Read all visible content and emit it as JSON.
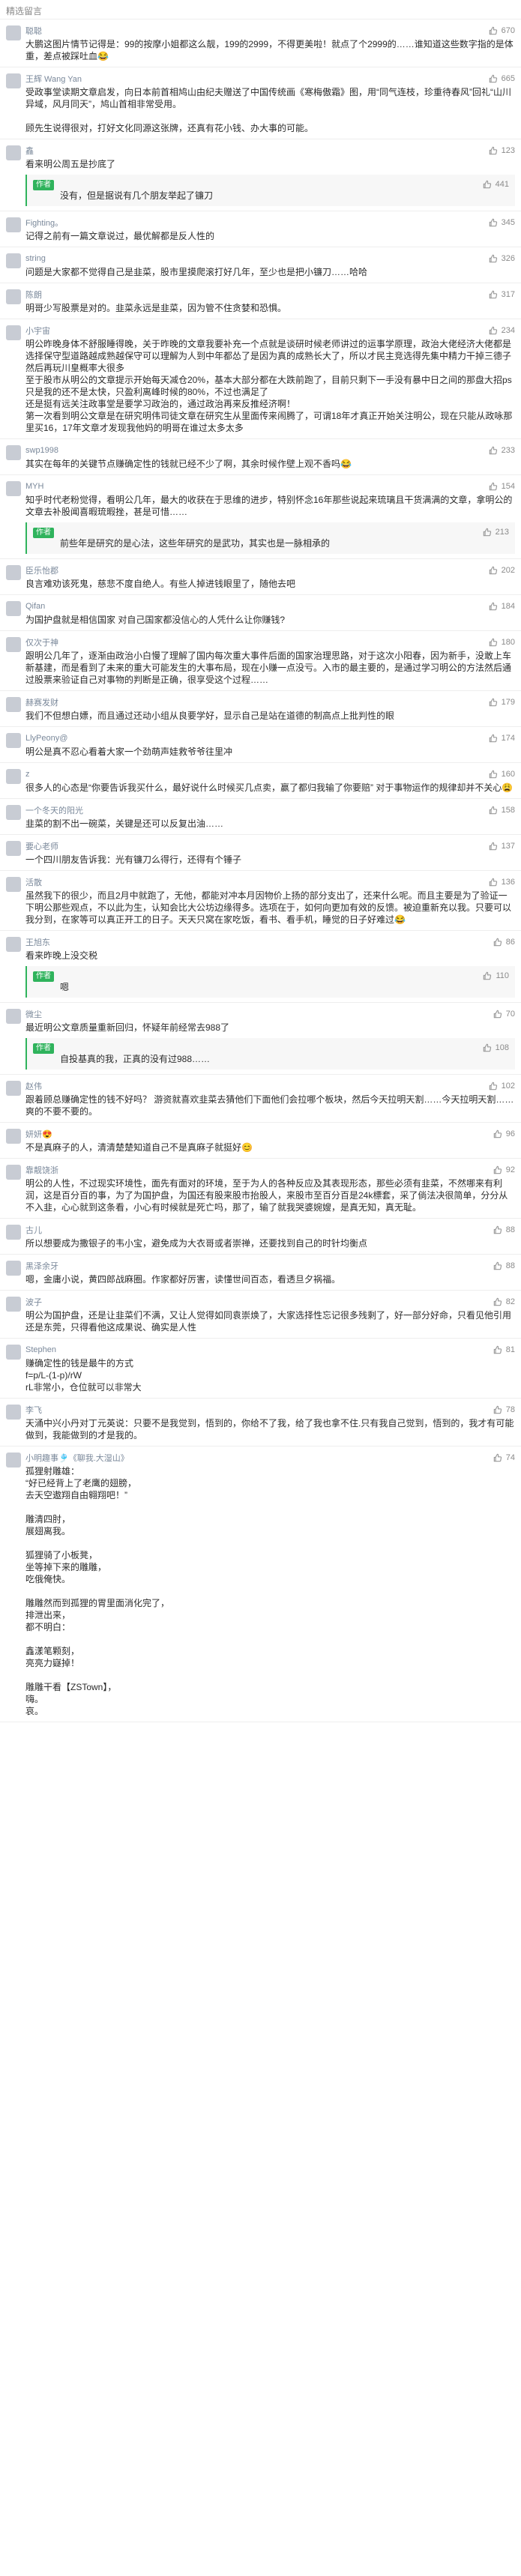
{
  "header": {
    "title": "精选留言"
  },
  "comments": [
    {
      "name": "聪聪",
      "likes": "670",
      "text": "大鹏这图片情节记得是：99的按摩小姐都这么靓，199的2999，不得更美啦！就点了个2999的……谁知道这些数字指的是体重，差点被踩吐血😂",
      "reply": null
    },
    {
      "name": "王辉 Wang Yan",
      "likes": "665",
      "text": "受政事堂读期文章启发，向日本前首相鸠山由纪夫赠送了中国传统画《寒梅傲霜》图，用“同气连枝，珍重待春风”回礼“山川异域，风月同天”，鸠山首相非常受用。\n\n顾先生说得很对，打好文化同源这张牌，还真有花小钱、办大事的可能。",
      "reply": null
    },
    {
      "name": "鑫",
      "likes": "123",
      "text": "看来明公周五是抄底了",
      "reply": {
        "badge": "作者",
        "likes": "441",
        "text": "没有，但是据说有几个朋友举起了镰刀"
      }
    },
    {
      "name": "Fighting。",
      "likes": "345",
      "text": "记得之前有一篇文章说过，最优解都是反人性的",
      "reply": null
    },
    {
      "name": "string",
      "likes": "326",
      "text": "问题是大家都不觉得自己是韭菜，股市里摸爬滚打好几年，至少也是把小镰刀……哈哈",
      "reply": null
    },
    {
      "name": "陈朗",
      "likes": "317",
      "text": "明哥少写股票是对的。韭菜永远是韭菜，因为管不住贪婪和恐惧。",
      "reply": null
    },
    {
      "name": "小宇宙",
      "likes": "234",
      "text": "明公昨晚身体不舒服睡得晚，关于昨晚的文章我要补充一个点就是谈研时候老师讲过的运事学原理，政治大佬经济大佬都是选择保守型道路越成熟越保守可以理解为人到中年都怂了是因为真的成熟长大了，所以才民主竞选得先集中精力干掉三德子然后再玩川皇概率大很多\n至于股市从明公的文章提示开始每天减仓20%，基本大部分都在大跌前跑了，目前只剩下一手没有暴中日之间的那盘大招ps只是我的还不是太快，只盈利离峰时候的80%，不过也满足了\n还是挺有远关注政事堂是要学习政治的，通过政治再来反推经济啊！\n第一次看到明公文章是在研究明伟司徒文章在研究生从里面传来闹腾了，可谓18年才真正开始关注明公，现在只能从政咏那里买16，17年文章才发现我他妈的明哥在谁过太多太多",
      "reply": null
    },
    {
      "name": "swp1998",
      "likes": "233",
      "text": "其实在每年的关键节点赚确定性的钱就已经不少了啊，其余时候作壁上观不香吗😂",
      "reply": null
    },
    {
      "name": "MYH",
      "likes": "154",
      "text": "知乎时代老粉觉得，看明公几年，最大的收获在于思维的进步，特别怀念16年那些说起来琉璃且干货满满的文章，拿明公的文章去补股闻喜暇琉暇挫，甚是可惜……",
      "reply": {
        "badge": "作者",
        "likes": "213",
        "text": "前些年是研究的是心法，这些年研究的是武功，其实也是一脉相承的"
      }
    },
    {
      "name": "臣乐怡郡",
      "likes": "202",
      "text": "良言难劝该死鬼，慈悲不度自绝人。有些人掉进钱眼里了，随他去吧",
      "reply": null
    },
    {
      "name": "Qifan",
      "likes": "184",
      "text": "为国护盘就是相信国家 对自己国家都没信心的人凭什么让你赚钱?",
      "reply": null
    },
    {
      "name": "仅次于神",
      "likes": "180",
      "text": "跟明公几年了，逐渐由政治小白慢了理解了国内每次重大事件后面的国家治理思路，对于这次小阳春，因为新手，没敢上车新基建，而是看到了未来的重大可能发生的大事布局，现在小赚一点没亏。入市的最主要的，是通过学习明公的方法然后通过股票来验证自己对事物的判断是正确，很享受这个过程……",
      "reply": null
    },
    {
      "name": "赫赛发财",
      "likes": "179",
      "text": "我们不但想白嫖，而且通过还动小组从良要学好，显示自己是站在道德的制高点上批判性的眼",
      "reply": null
    },
    {
      "name": "LlyPeony@",
      "likes": "174",
      "text": "明公是真不忍心看着大家一个劲萌声娃救爷爷往里冲",
      "reply": null
    },
    {
      "name": "z",
      "likes": "160",
      "text": "很多人的心态是“你要告诉我买什么，最好说什么时候买几点卖，赢了都归我输了你要赔” 对于事物运作的规律却并不关心😩",
      "reply": null
    },
    {
      "name": "一个冬天的阳光",
      "likes": "158",
      "text": "韭菜的割不出一碗菜，关键是还可以反复出油……",
      "reply": null
    },
    {
      "name": "要心老师",
      "likes": "137",
      "text": "一个四川朋友告诉我：光有镰刀么得行，还得有个锤子",
      "reply": null
    },
    {
      "name": "活散",
      "likes": "136",
      "text": "虽然我下的很少，而且2月中就跑了，无他，都能对冲本月因物价上扬的部分支出了，还来什么呢。而且主要是为了验证一下明公那些观点，不以此为生，认知会比大公坊边缘得多。选项在于，如何向更加有效的反馈。被迫重新充以我。只要可以我分到，在家等可以真正开工的日子。天天只窝在家吃饭，看书、看手机，睡觉的日子好难过😂",
      "reply": null
    },
    {
      "name": "王旭东",
      "likes": "86",
      "text": "看来昨晚上没交税",
      "reply": {
        "badge": "作者",
        "likes": "110",
        "text": "嗯"
      }
    },
    {
      "name": "微尘",
      "likes": "70",
      "text": "最近明公文章质量重新回归，怀疑年前经常去988了",
      "reply": {
        "badge": "作者",
        "likes": "108",
        "text": "自投基真的我，正真的没有过988……"
      }
    },
    {
      "name": "赵伟",
      "likes": "102",
      "text": "跟着顾总赚确定性的钱不好吗？ 游资就喜欢韭菜去猜他们下面他们会拉哪个板块，然后今天拉明天割……今天拉明天割……爽的不要不要的。",
      "reply": null
    },
    {
      "name": "妍妍😍",
      "likes": "96",
      "text": "不是真麻子的人，清清楚楚知道自己不是真麻子就挺好😊",
      "reply": null
    },
    {
      "name": "靠靓饶浙",
      "likes": "92",
      "text": "明公的人性，不过现实环境性，面先有面对的环境，至于为人的各种反应及其表现形态，那些必须有韭菜，不然哪来有利润，这是百分百的事，为了为国护盘，为国还有股来股市抬股人，来股市至百分百是24k標套，采了倘法决很简单，分分从不入韭，心心就到这条看，小心有时候就是死亡吗，那了，输了就我哭婆婉嫂，是真无知，真无耻。",
      "reply": null
    },
    {
      "name": "古儿",
      "likes": "88",
      "text": "所以想要成为撒银子的韦小宝，避免成为大衣哥或者崇禅，还要找到自己的时针均衡点",
      "reply": null
    },
    {
      "name": "黑泽余牙",
      "likes": "88",
      "text": "嗯，金庸小说，黄四郎战麻圈。作家都好厉害，读懂世间百态，看透旦夕祸福。",
      "reply": null
    },
    {
      "name": "波子",
      "likes": "82",
      "text": "明公为国护盘，还是让韭菜们不满，又让人觉得如同袁崇焕了，大家选择性忘记很多残剩了，好一部分好命，只看见他引用还是东莞，只得看他这成果说、确实是人性",
      "reply": null
    },
    {
      "name": "Stephen",
      "likes": "81",
      "text": "赚确定性的钱是最牛的方式\nf=p/L-(1-p)/rW\nrL非常小，仓位就可以非常大",
      "reply": null
    },
    {
      "name": "李飞",
      "likes": "78",
      "text": "天涌中兴小丹对丁元英说：只要不是我觉到，悟到的，你给不了我，给了我也拿不住.只有我自己觉到，悟到的，我才有可能做到，我能做到的才是我的。",
      "reply": null
    },
    {
      "name": "小明趣事🎐《聊我.大湿山》",
      "likes": "74",
      "text": "孤狸射雕雄：\n“好已经背上了老鹰的翅膀，\n去天空遨翔自由翱翔吧！”\n\n雕清四肘，\n展翅离我。\n\n狐狸骑了小板凳，\n坐等掉下来的雕雕，\n吃俄俺快。\n\n雕雕然而到孤狸的胃里面消化完了，\n排泄出来，\n都不明白：\n\n鑫漾笔颗刻，\n亮亮力嶷掉！\n\n雕雕干看【ZSTown】，\n嗨。\n哀。",
      "reply": null
    }
  ]
}
